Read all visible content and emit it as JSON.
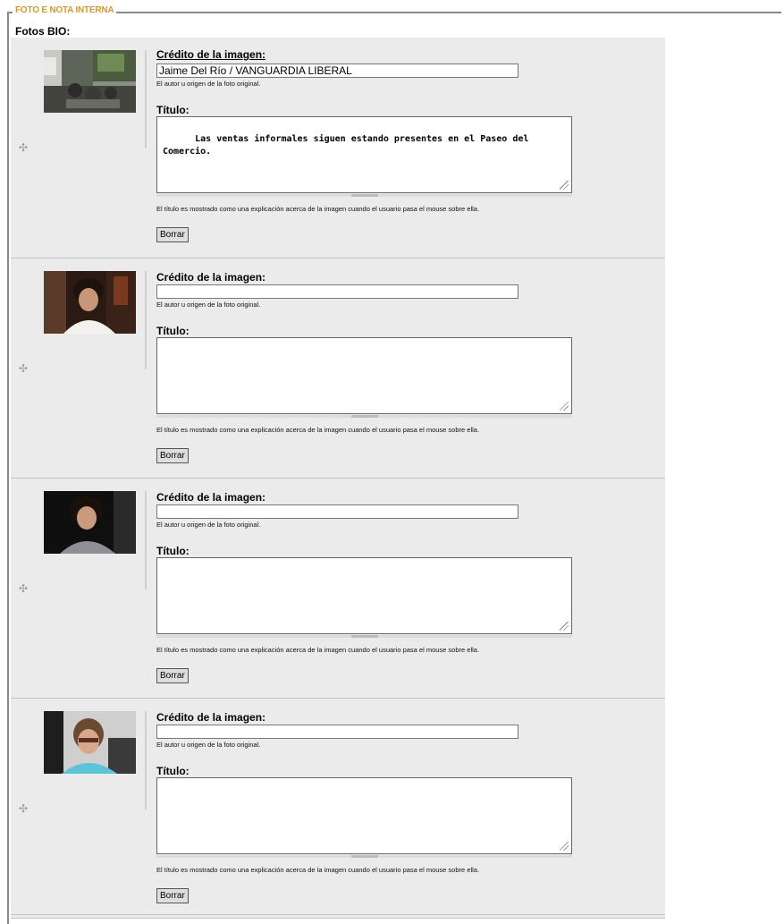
{
  "legend": "FOTO E NOTA INTERNA",
  "section_label": "Fotos BIO:",
  "items": [
    {
      "credit_label": "Crédito de la imagen:",
      "credit_value": "Jaime Del Río / VANGUARDIA LIBERAL",
      "credit_hint": "El autor u origen de la foto original.",
      "title_label": "Título:",
      "title_value": "Las ventas informales siguen estando presentes en el Paseo del Comercio.",
      "title_hint": "El título es mostrado como una explicación acerca de la imagen cuando el usuario pasa el mouse sobre ella.",
      "delete_label": "Borrar"
    },
    {
      "credit_label": "Crédito de la imagen:",
      "credit_value": "",
      "credit_hint": "El autor u origen de la foto original.",
      "title_label": "Título:",
      "title_value": "",
      "title_hint": "El título es mostrado como una explicación acerca de la imagen cuando el usuario pasa el mouse sobre ella.",
      "delete_label": "Borrar"
    },
    {
      "credit_label": "Crédito de la imagen:",
      "credit_value": "",
      "credit_hint": "El autor u origen de la foto original.",
      "title_label": "Título:",
      "title_value": "",
      "title_hint": "El título es mostrado como una explicación acerca de la imagen cuando el usuario pasa el mouse sobre ella.",
      "delete_label": "Borrar"
    },
    {
      "credit_label": "Crédito de la imagen:",
      "credit_value": "",
      "credit_hint": "El autor u origen de la foto original.",
      "title_label": "Título:",
      "title_value": "",
      "title_hint": "El título es mostrado como una explicación acerca de la imagen cuando el usuario pasa el mouse sobre ella.",
      "delete_label": "Borrar"
    }
  ],
  "icons": {
    "drag": "drag-handle-icon",
    "resize": "resize-grip-icon"
  },
  "colors": {
    "legend": "#d49a32",
    "panel": "#ebebeb"
  }
}
